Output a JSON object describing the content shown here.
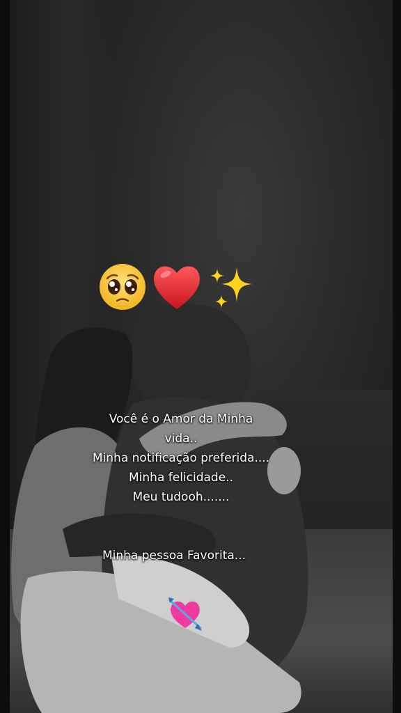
{
  "caption": {
    "lines": [
      "Você é o Amor da Minha",
      "vida..",
      "Minha notificação preferida....",
      "Minha felicidade..",
      "Meu tudooh......."
    ],
    "favorite": "Minha pessoa Favorita..."
  },
  "emojis": [
    "pleading-face-icon",
    "red-heart-icon",
    "sparkles-icon",
    "heart-with-arrow-icon"
  ],
  "colors": {
    "caption_text": "#ffffff",
    "heart": "#e0242f",
    "heart_arrow": "#f03aa0",
    "sparkles": "#ffd21f"
  }
}
